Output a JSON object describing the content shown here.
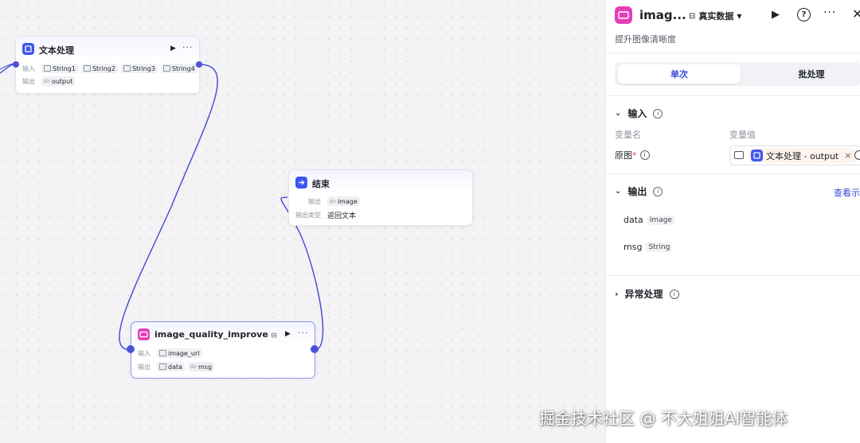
{
  "canvas": {
    "node_text": {
      "title": "文本处理",
      "input_label": "输入",
      "output_label": "输出",
      "inputs": [
        "String1",
        "String2",
        "String3",
        "String4"
      ],
      "output": "output"
    },
    "node_end": {
      "title": "结束",
      "output_label": "输出",
      "output": "image",
      "output_type_label": "输出类型",
      "output_type_value": "返回文本"
    },
    "node_image": {
      "title": "image_quality_improve",
      "input_label": "输入",
      "output_label": "输出",
      "input": "image_url",
      "outputs": [
        "data",
        "msg"
      ]
    },
    "str_tag": "str"
  },
  "panel": {
    "title": "imag...",
    "mode_label": "真实数据",
    "subtitle": "提升图像清晰度",
    "tabs": [
      "单次",
      "批处理"
    ],
    "input_section": {
      "title": "输入",
      "col_name": "变量名",
      "col_value": "变量值",
      "field_name": "原图",
      "required_mark": "*",
      "chip_text": "文本处理 - output",
      "chip_close": "×"
    },
    "output_section": {
      "title": "输出",
      "view_link": "查看示",
      "items": [
        {
          "name": "data",
          "type": "Image"
        },
        {
          "name": "msg",
          "type": "String"
        }
      ]
    },
    "error_section": {
      "title": "异常处理"
    }
  },
  "watermark": "掘金技术社区 @ 不大姐姐AI智能体",
  "colors": {
    "accent": "#3548d9",
    "edge": "#4b52d8",
    "plugin": "#e43fb9",
    "node_icon": "#3e57f0"
  }
}
